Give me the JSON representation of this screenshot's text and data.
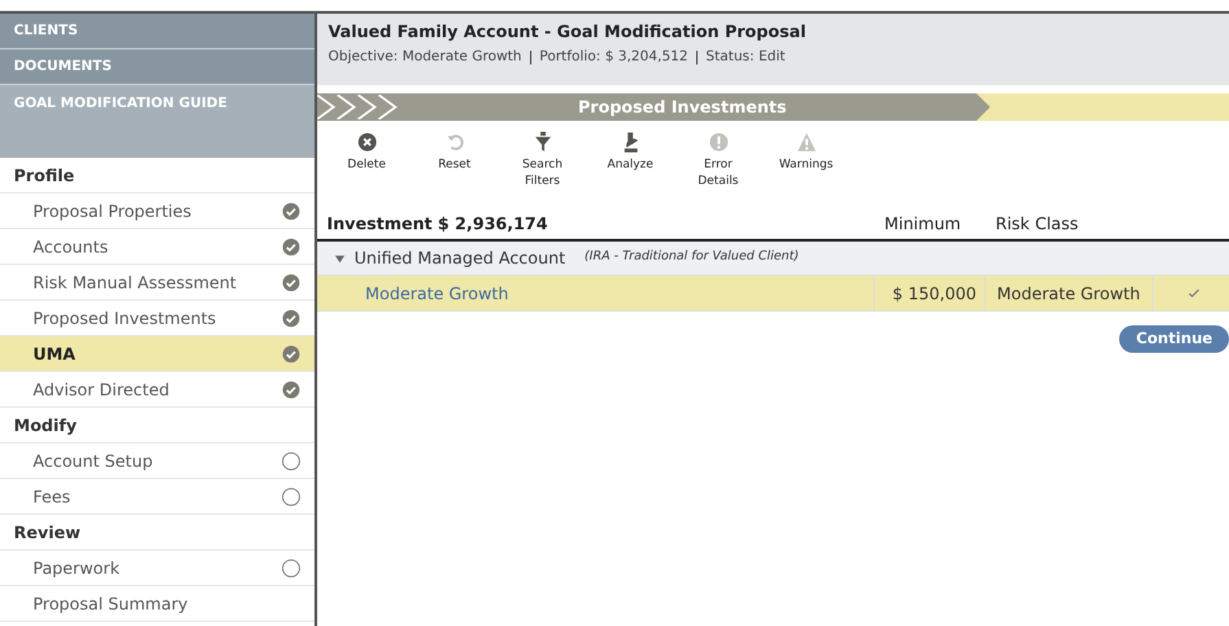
{
  "nav": [
    {
      "label": "CLIENTS",
      "kind": "link"
    },
    {
      "label": "DOCUMENTS",
      "kind": "link"
    },
    {
      "label": "GOAL MODIFICATION GUIDE",
      "kind": "guide"
    }
  ],
  "steps": [
    {
      "label": "Profile",
      "items": [
        {
          "label": "Proposal Properties",
          "kind": "done",
          "selected": false
        },
        {
          "label": "Accounts",
          "kind": "done",
          "selected": false
        },
        {
          "label": "Risk Manual Assessment",
          "kind": "done",
          "selected": false
        },
        {
          "label": "Proposed Investments",
          "kind": "done",
          "selected": false
        },
        {
          "label": "UMA",
          "kind": "done",
          "selected": true
        },
        {
          "label": "Advisor Directed",
          "kind": "done",
          "selected": false
        }
      ]
    },
    {
      "label": "Modify",
      "items": [
        {
          "label": "Account Setup",
          "kind": "pending",
          "selected": false
        },
        {
          "label": "Fees",
          "kind": "pending",
          "selected": false
        }
      ]
    },
    {
      "label": "Review",
      "items": [
        {
          "label": "Paperwork",
          "kind": "pending",
          "selected": false
        },
        {
          "label": "Proposal Summary",
          "selected": false
        }
      ]
    }
  ],
  "header": {
    "title": "Valued Family Account - Goal Modification Proposal",
    "meta": [
      "Objective: Moderate Growth",
      "Portfolio: $ 3,204,512",
      "Status: Edit"
    ]
  },
  "banner": {
    "title": "Proposed Investments"
  },
  "toolbar": [
    {
      "label": "Delete",
      "disabled": false
    },
    {
      "label": "Reset",
      "disabled": true
    },
    {
      "label": "Search Filters",
      "disabled": false
    },
    {
      "label": "Analyze",
      "disabled": false
    },
    {
      "label": "Error Details",
      "disabled": true
    },
    {
      "label": "Warnings",
      "disabled": true
    }
  ],
  "table": {
    "investment_label": "Investment",
    "investment_total": "$ 2,936,174",
    "columns": [
      "Minimum",
      "Risk Class"
    ],
    "groups": [
      {
        "name": "Unified Managed Account",
        "note": "(IRA - Traditional for Valued Client)",
        "expanded": true,
        "rows": [
          {
            "name": "Moderate Growth",
            "minimum": "$ 150,000",
            "risk_class": "Moderate Growth",
            "checked": true
          }
        ]
      }
    ]
  },
  "continue_button": "Continue"
}
